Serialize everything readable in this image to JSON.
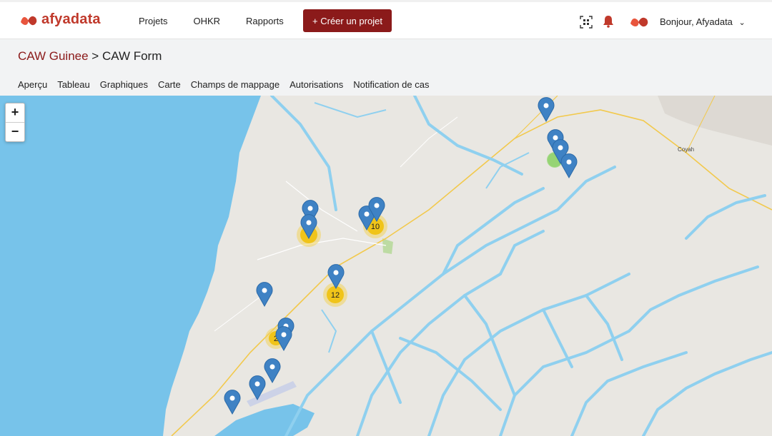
{
  "brand": {
    "name": "afyadata",
    "color": "#c0392b"
  },
  "nav": {
    "items": [
      "Projets",
      "OHKR",
      "Rapports"
    ]
  },
  "create_button": {
    "label": "+ Créer un projet",
    "color": "#8b1a1a"
  },
  "header_icons": {
    "scan": "qr-scan-icon",
    "bell": "bell-icon",
    "avatar": "avatar-logo"
  },
  "user": {
    "greeting": "Bonjour, Afyadata",
    "caret": "⌄"
  },
  "breadcrumb": {
    "project": "CAW Guinee",
    "separator": " > ",
    "current": "CAW Form"
  },
  "tabs": [
    "Aperçu",
    "Tableau",
    "Graphiques",
    "Carte",
    "Champs de mappage",
    "Autorisations",
    "Notification de cas"
  ],
  "map": {
    "zoom_in": "+",
    "zoom_out": "−",
    "colors": {
      "sea": "#77c3ea",
      "land": "#e9e7e2",
      "river": "#8fd0ef",
      "marker": "#3f82c4",
      "cluster": "#f3d24f"
    },
    "clusters": [
      "10",
      "12",
      "2"
    ],
    "places": {
      "coyah": "Coyah"
    }
  }
}
